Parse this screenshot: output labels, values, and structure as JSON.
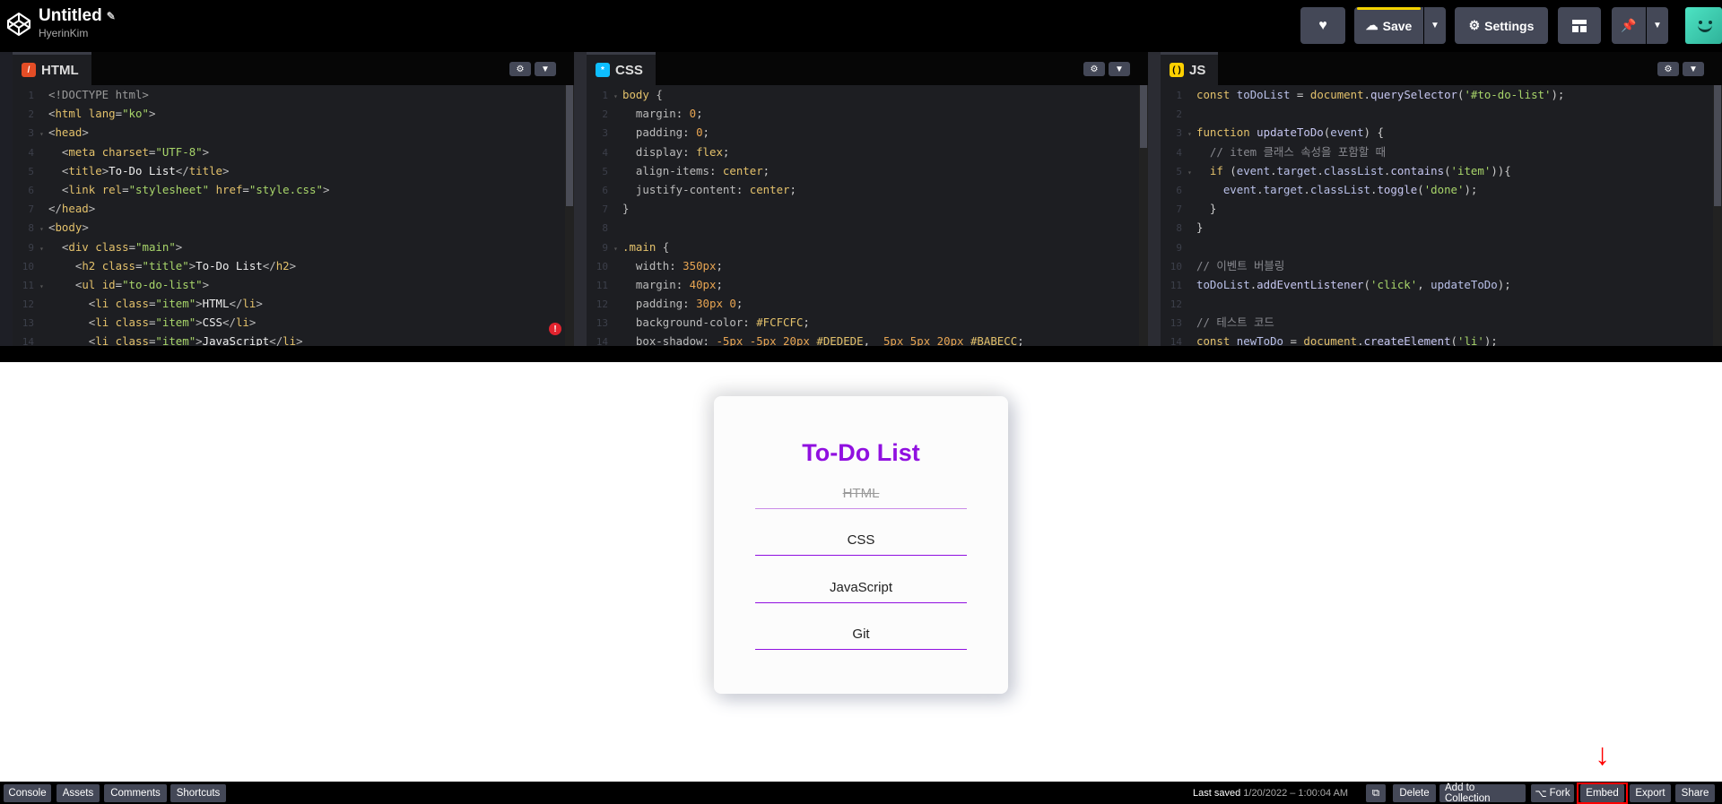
{
  "header": {
    "title": "Untitled",
    "username": "HyerinKim",
    "save_label": "Save",
    "settings_label": "Settings"
  },
  "editors": {
    "html": {
      "label": "HTML",
      "lines": [
        {
          "n": "1",
          "fold": "",
          "html": "<span class='t-doc'>&lt;!DOCTYPE html&gt;</span>"
        },
        {
          "n": "2",
          "fold": "",
          "html": "<span class='t-tag'>&lt;</span><span class='t-el'>html</span> <span class='t-attr'>lang</span>=<span class='t-str'>\"ko\"</span><span class='t-tag'>&gt;</span>"
        },
        {
          "n": "3",
          "fold": "▾",
          "html": "<span class='t-tag'>&lt;</span><span class='t-el'>head</span><span class='t-tag'>&gt;</span>"
        },
        {
          "n": "4",
          "fold": "",
          "html": "  <span class='t-tag'>&lt;</span><span class='t-el'>meta</span> <span class='t-attr'>charset</span>=<span class='t-str'>\"UTF-8\"</span><span class='t-tag'>&gt;</span>"
        },
        {
          "n": "5",
          "fold": "",
          "html": "  <span class='t-tag'>&lt;</span><span class='t-el'>title</span><span class='t-tag'>&gt;</span><span style='color:#eee'>To-Do List</span><span class='t-tag'>&lt;/</span><span class='t-el'>title</span><span class='t-tag'>&gt;</span>"
        },
        {
          "n": "6",
          "fold": "",
          "html": "  <span class='t-tag'>&lt;</span><span class='t-el'>link</span> <span class='t-attr'>rel</span>=<span class='t-str'>\"stylesheet\"</span> <span class='t-attr'>href</span>=<span class='t-str'>\"style.css\"</span><span class='t-tag'>&gt;</span>"
        },
        {
          "n": "7",
          "fold": "",
          "html": "<span class='t-tag'>&lt;/</span><span class='t-el'>head</span><span class='t-tag'>&gt;</span>"
        },
        {
          "n": "8",
          "fold": "▾",
          "html": "<span class='t-tag'>&lt;</span><span class='t-el'>body</span><span class='t-tag'>&gt;</span>"
        },
        {
          "n": "9",
          "fold": "▾",
          "html": "  <span class='t-tag'>&lt;</span><span class='t-el'>div</span> <span class='t-attr'>class</span>=<span class='t-str'>\"main\"</span><span class='t-tag'>&gt;</span>"
        },
        {
          "n": "10",
          "fold": "",
          "html": "    <span class='t-tag'>&lt;</span><span class='t-el'>h2</span> <span class='t-attr'>class</span>=<span class='t-str'>\"title\"</span><span class='t-tag'>&gt;</span><span style='color:#eee'>To-Do List</span><span class='t-tag'>&lt;/</span><span class='t-el'>h2</span><span class='t-tag'>&gt;</span>"
        },
        {
          "n": "11",
          "fold": "▾",
          "html": "    <span class='t-tag'>&lt;</span><span class='t-el'>ul</span> <span class='t-attr'>id</span>=<span class='t-str'>\"to-do-list\"</span><span class='t-tag'>&gt;</span>"
        },
        {
          "n": "12",
          "fold": "",
          "html": "      <span class='t-tag'>&lt;</span><span class='t-el'>li</span> <span class='t-attr'>class</span>=<span class='t-str'>\"item\"</span><span class='t-tag'>&gt;</span><span style='color:#eee'>HTML</span><span class='t-tag'>&lt;/</span><span class='t-el'>li</span><span class='t-tag'>&gt;</span>"
        },
        {
          "n": "13",
          "fold": "",
          "html": "      <span class='t-tag'>&lt;</span><span class='t-el'>li</span> <span class='t-attr'>class</span>=<span class='t-str'>\"item\"</span><span class='t-tag'>&gt;</span><span style='color:#eee'>CSS</span><span class='t-tag'>&lt;/</span><span class='t-el'>li</span><span class='t-tag'>&gt;</span>"
        },
        {
          "n": "14",
          "fold": "",
          "html": "      <span class='t-tag'>&lt;</span><span class='t-el'>li</span> <span class='t-attr'>class</span>=<span class='t-str'>\"item\"</span><span class='t-tag'>&gt;</span><span style='color:#eee'>JavaScript</span><span class='t-tag'>&lt;/</span><span class='t-el'>li</span><span class='t-tag'>&gt;</span>"
        }
      ]
    },
    "css": {
      "label": "CSS",
      "lines": [
        {
          "n": "1",
          "fold": "▾",
          "html": "<span class='t-sel'>body</span> <span class='t-tag'>{</span>"
        },
        {
          "n": "2",
          "fold": "",
          "html": "  <span class='t-prop'>margin</span>: <span class='t-val'>0</span>;"
        },
        {
          "n": "3",
          "fold": "",
          "html": "  <span class='t-prop'>padding</span>: <span class='t-val'>0</span>;"
        },
        {
          "n": "4",
          "fold": "",
          "html": "  <span class='t-prop'>display</span>: <span class='t-kw'>flex</span>;"
        },
        {
          "n": "5",
          "fold": "",
          "html": "  <span class='t-prop'>align-items</span>: <span class='t-kw'>center</span>;"
        },
        {
          "n": "6",
          "fold": "",
          "html": "  <span class='t-prop'>justify-content</span>: <span class='t-kw'>center</span>;"
        },
        {
          "n": "7",
          "fold": "",
          "html": "<span class='t-tag'>}</span>"
        },
        {
          "n": "8",
          "fold": "",
          "html": ""
        },
        {
          "n": "9",
          "fold": "▾",
          "html": "<span class='t-sel'>.main</span> <span class='t-tag'>{</span>"
        },
        {
          "n": "10",
          "fold": "",
          "html": "  <span class='t-prop'>width</span>: <span class='t-val'>350px</span>;"
        },
        {
          "n": "11",
          "fold": "",
          "html": "  <span class='t-prop'>margin</span>: <span class='t-val'>40px</span>;"
        },
        {
          "n": "12",
          "fold": "",
          "html": "  <span class='t-prop'>padding</span>: <span class='t-val'>30px</span> <span class='t-val'>0</span>;"
        },
        {
          "n": "13",
          "fold": "",
          "html": "  <span class='t-prop'>background-color</span>: <span class='t-kw'>#FCFCFC</span>;"
        },
        {
          "n": "14",
          "fold": "",
          "html": "  <span class='t-prop'>box-shadow</span>: <span class='t-val'>-5px -5px 20px</span> <span class='t-kw'>#DEDEDE</span>,  <span class='t-val'>5px 5px 20px</span> <span class='t-kw'>#BABECC</span>;"
        }
      ]
    },
    "js": {
      "label": "JS",
      "lines": [
        {
          "n": "1",
          "fold": "",
          "html": "<span class='t-kw'>const</span> <span class='t-js'>toDoList</span> = <span class='t-el'>document</span>.<span class='t-fn'>querySelector</span>(<span class='t-str'>'#to-do-list'</span>);"
        },
        {
          "n": "2",
          "fold": "",
          "html": ""
        },
        {
          "n": "3",
          "fold": "▾",
          "html": "<span class='t-kw'>function</span> <span class='t-fn'>updateToDo</span>(<span class='t-js'>event</span>) {"
        },
        {
          "n": "4",
          "fold": "",
          "html": "  <span class='t-com'>// item 클래스 속성을 포함할 때</span>"
        },
        {
          "n": "5",
          "fold": "▾",
          "html": "  <span class='t-kw'>if</span> (<span class='t-js'>event</span>.<span class='t-js'>target</span>.<span class='t-js'>classList</span>.<span class='t-fn'>contains</span>(<span class='t-str'>'item'</span>)){"
        },
        {
          "n": "6",
          "fold": "",
          "html": "    <span class='t-js'>event</span>.<span class='t-js'>target</span>.<span class='t-js'>classList</span>.<span class='t-fn'>toggle</span>(<span class='t-str'>'done'</span>);"
        },
        {
          "n": "7",
          "fold": "",
          "html": "  }"
        },
        {
          "n": "8",
          "fold": "",
          "html": "}"
        },
        {
          "n": "9",
          "fold": "",
          "html": ""
        },
        {
          "n": "10",
          "fold": "",
          "html": "<span class='t-com'>// 이벤트 버블링</span>"
        },
        {
          "n": "11",
          "fold": "",
          "html": "<span class='t-js'>toDoList</span>.<span class='t-fn'>addEventListener</span>(<span class='t-str'>'click'</span>, <span class='t-js'>updateToDo</span>);"
        },
        {
          "n": "12",
          "fold": "",
          "html": ""
        },
        {
          "n": "13",
          "fold": "",
          "html": "<span class='t-com'>// 테스트 코드</span>"
        },
        {
          "n": "14",
          "fold": "",
          "html": "<span class='t-kw'>const</span> <span class='t-js'>newToDo</span> = <span class='t-el'>document</span>.<span class='t-fn'>createElement</span>(<span class='t-str'>'li'</span>);"
        }
      ]
    }
  },
  "preview": {
    "title": "To-Do List",
    "items": [
      {
        "label": "HTML",
        "done": true
      },
      {
        "label": "CSS",
        "done": false
      },
      {
        "label": "JavaScript",
        "done": false
      },
      {
        "label": "Git",
        "done": false
      }
    ]
  },
  "footer": {
    "console": "Console",
    "assets": "Assets",
    "comments": "Comments",
    "shortcuts": "Shortcuts",
    "last_saved_label": "Last saved",
    "last_saved_value": "1/20/2022 – 1:00:04 AM",
    "delete": "Delete",
    "add_to_collection": "Add to Collection",
    "fork": "Fork",
    "embed": "Embed",
    "export": "Export",
    "share": "Share"
  },
  "colors": {
    "accent_purple": "#9010e0",
    "highlight_red": "#ff0000",
    "save_bar_yellow": "#f2d200"
  },
  "icons": [
    "codepen-logo-icon",
    "pencil-icon",
    "heart-icon",
    "cloud-icon",
    "gear-icon",
    "layout-icon",
    "pin-icon",
    "chevron-down-icon",
    "external-link-icon",
    "fork-icon",
    "error-icon",
    "down-arrow-icon"
  ]
}
